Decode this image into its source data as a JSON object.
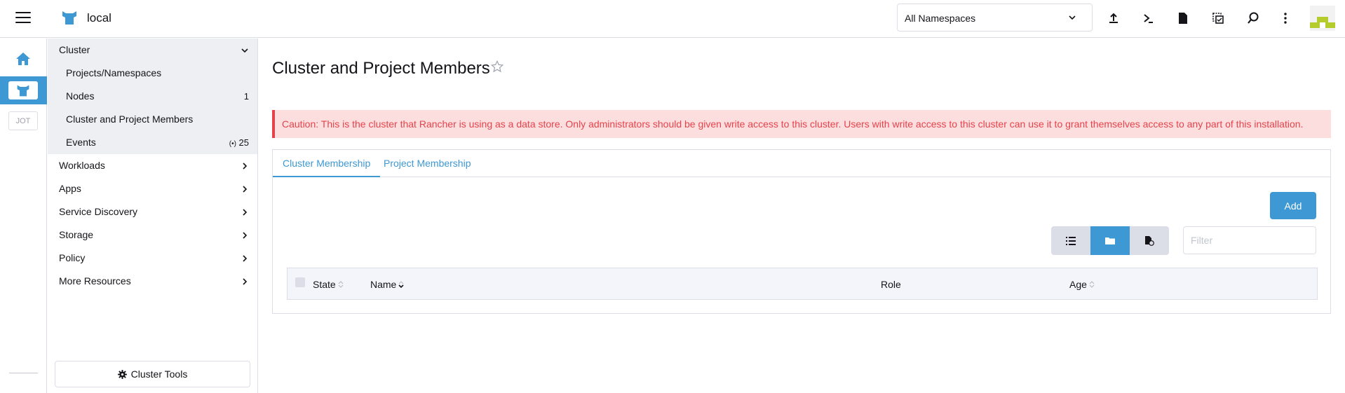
{
  "header": {
    "cluster_name": "local",
    "namespace_select": "All Namespaces",
    "tools": [
      "import-yaml-icon",
      "kubectl-shell-icon",
      "kubeconfig-file-icon",
      "copy-kubeconfig-icon",
      "search-icon",
      "more-icon"
    ]
  },
  "rail": {
    "jot_label": "JOT"
  },
  "nav": {
    "cluster_group": "Cluster",
    "cluster_items": [
      {
        "label": "Projects/Namespaces",
        "count": ""
      },
      {
        "label": "Nodes",
        "count": "1"
      },
      {
        "label": "Cluster and Project Members",
        "count": ""
      },
      {
        "label": "Events",
        "count": "25",
        "count_prefix": "(•)"
      }
    ],
    "groups": [
      "Workloads",
      "Apps",
      "Service Discovery",
      "Storage",
      "Policy",
      "More Resources"
    ],
    "cluster_tools": "Cluster Tools"
  },
  "main": {
    "title": "Cluster and Project Members",
    "banner": "Caution: This is the cluster that Rancher is using as a data store. Only administrators should be given write access to this cluster. Users with write access to this cluster can use it to grant themselves access to any part of this installation.",
    "tabs": [
      "Cluster Membership",
      "Project Membership"
    ],
    "add_label": "Add",
    "filter_placeholder": "Filter",
    "table_headers": {
      "state": "State",
      "name": "Name",
      "role": "Role",
      "age": "Age"
    }
  },
  "colors": {
    "accent": "#3d98d3",
    "error": "#e5434c",
    "error_bg": "#fcdede"
  }
}
